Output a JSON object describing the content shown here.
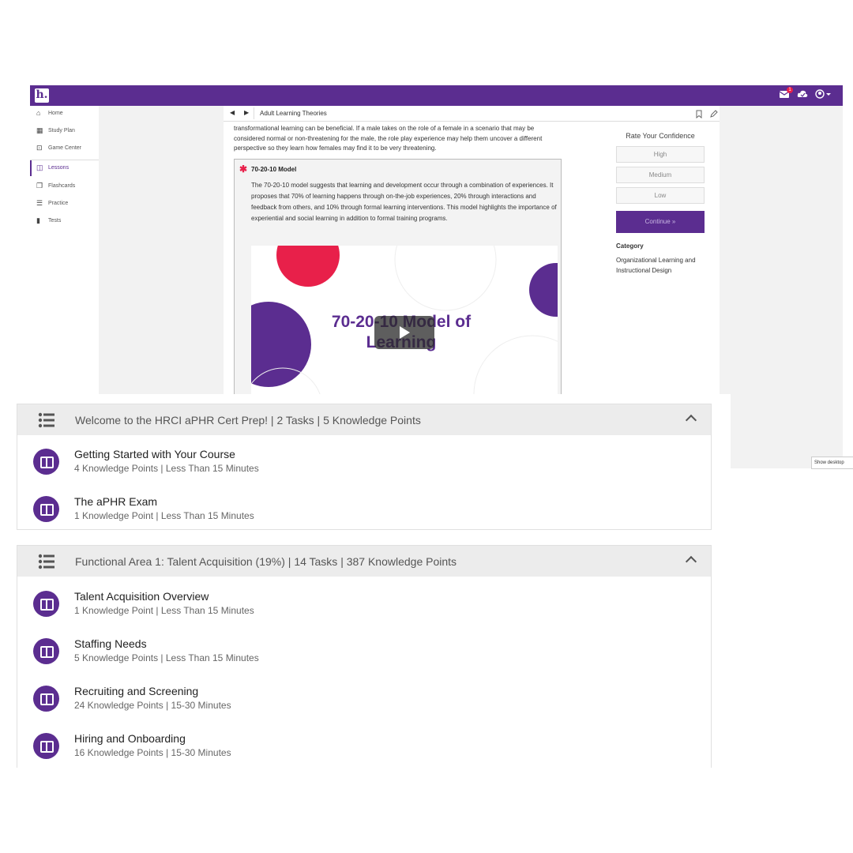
{
  "app": {
    "logo_text": "h.",
    "notification_count": "1",
    "nav_items": [
      {
        "label": "Home",
        "icon": "home-icon"
      },
      {
        "label": "Study Plan",
        "icon": "calendar-icon"
      },
      {
        "label": "Game Center",
        "icon": "game-icon"
      },
      {
        "label": "Lessons",
        "icon": "book-icon",
        "active": true
      },
      {
        "label": "Flashcards",
        "icon": "flashcards-icon"
      },
      {
        "label": "Practice",
        "icon": "practice-icon"
      },
      {
        "label": "Tests",
        "icon": "clipboard-icon"
      }
    ]
  },
  "lesson": {
    "title": "Adult Learning Theories",
    "paragraph": "transformational learning can be beneficial. If a male takes on the role of a female in a scenario that may be considered normal or non-threatening for the male, the role play experience may help them uncover a different perspective so they learn how females may find it to be very threatening.",
    "callout": {
      "title": "70-20-10 Model",
      "text": "The 70-20-10 model suggests that learning and development occur through a combination of experiences. It proposes that 70% of learning happens through on-the-job experiences, 20% through interactions and feedback from others, and 10% through formal learning interventions. This model highlights the importance of experiential and social learning in addition to formal training programs."
    },
    "video_title": "70-20-10 Model of Learning"
  },
  "confidence": {
    "label": "Rate Your Confidence",
    "options": [
      "High",
      "Medium",
      "Low"
    ],
    "continue_label": "Continue »",
    "category_label": "Category",
    "category_value": "Organizational Learning and Instructional Design"
  },
  "tooltip": "Show desktop",
  "sections": [
    {
      "title": "Welcome to the HRCI aPHR Cert Prep! | 2 Tasks | 5 Knowledge Points",
      "tasks": [
        {
          "name": "Getting Started with Your Course",
          "meta": "4 Knowledge Points |  Less Than 15 Minutes"
        },
        {
          "name": "The aPHR Exam",
          "meta": "1 Knowledge Point |  Less Than 15 Minutes"
        }
      ]
    },
    {
      "title": "Functional Area 1: Talent Acquisition (19%) | 14 Tasks | 387 Knowledge Points",
      "tasks": [
        {
          "name": "Talent Acquisition Overview",
          "meta": "1 Knowledge Point |  Less Than 15 Minutes"
        },
        {
          "name": "Staffing Needs",
          "meta": "5 Knowledge Points |  Less Than 15 Minutes"
        },
        {
          "name": "Recruiting and Screening",
          "meta": "24 Knowledge Points |  15-30 Minutes"
        },
        {
          "name": "Hiring and Onboarding",
          "meta": "16 Knowledge Points |  15-30 Minutes"
        }
      ]
    }
  ],
  "colors": {
    "brand": "#5b2d90",
    "accent": "#e8204a"
  }
}
